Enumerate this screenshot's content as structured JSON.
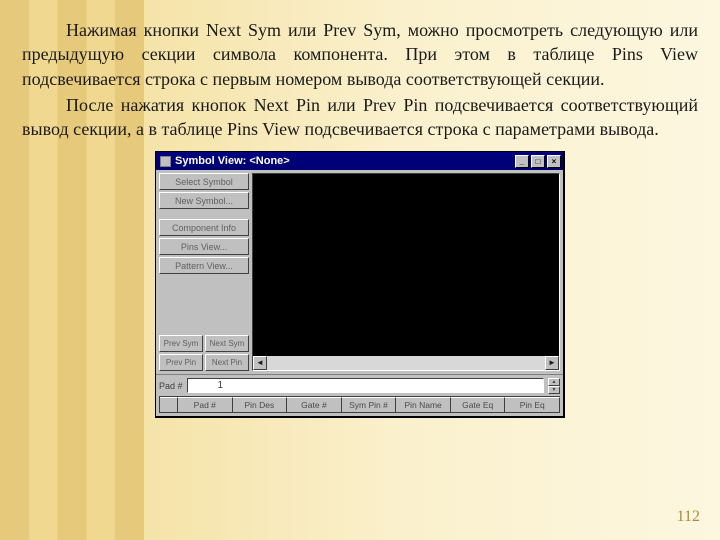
{
  "page": {
    "para1": "Нажимая кнопки Next Sym или Prev Sym, можно просмотреть следующую или предыдущую секции символа компонента. При этом в таблице Pins View подсвечивается строка с первым номером вывода соответствующей секции.",
    "para2": "После нажатия кнопок Next Pin или Prev Pin подсвечивается соответствующий вывод секции, а в таблице Pins View подсвечивается строка с параметрами вывода.",
    "number": "112"
  },
  "win": {
    "title": "Symbol View: <None>",
    "min": "_",
    "max": "□",
    "close": "×",
    "buttons": {
      "select": "Select Symbol",
      "newsym": "New Symbol...",
      "component": "Component Info",
      "pinsview": "Pins View...",
      "patternview": "Pattern View..."
    },
    "nav": {
      "prevsym": "Prev Sym",
      "nextsym": "Next Sym",
      "prevpin": "Prev Pin",
      "nextpin": "Next Pin"
    },
    "scroll": {
      "left": "◄",
      "right": "►"
    },
    "lower": {
      "pad_label": "Pad #",
      "pad_value": "1",
      "spin_up": "▲",
      "spin_down": "▼",
      "headers": [
        "",
        "Pad #",
        "Pin Des",
        "Gate #",
        "Sym Pin #",
        "Pin Name",
        "Gate Eq",
        "Pin Eq"
      ]
    }
  }
}
